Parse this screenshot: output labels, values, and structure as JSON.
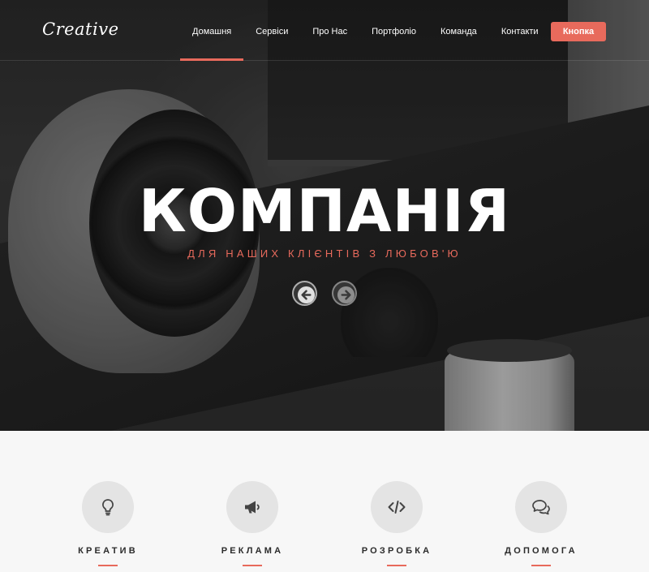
{
  "brand": {
    "logo": "Creative",
    "accent": "#e86a5c"
  },
  "nav": {
    "items": [
      {
        "label": "Домашня",
        "active": true
      },
      {
        "label": "Сервіси"
      },
      {
        "label": "Про Нас"
      },
      {
        "label": "Портфоліо"
      },
      {
        "label": "Команда"
      },
      {
        "label": "Контакти"
      }
    ],
    "cta_label": "Кнопка"
  },
  "hero": {
    "title": "КОМПАНІЯ",
    "subtitle": "ДЛЯ НАШИХ КЛІЄНТІВ З ЛЮБОВ'Ю",
    "prev_icon": "arrow-left-icon",
    "next_icon": "arrow-right-icon"
  },
  "features": [
    {
      "label": "КРЕАТИВ",
      "icon": "lightbulb-icon"
    },
    {
      "label": "РЕКЛАМА",
      "icon": "megaphone-icon"
    },
    {
      "label": "РОЗРОБКА",
      "icon": "code-icon"
    },
    {
      "label": "ДОПОМОГА",
      "icon": "chat-bubbles-icon"
    }
  ]
}
